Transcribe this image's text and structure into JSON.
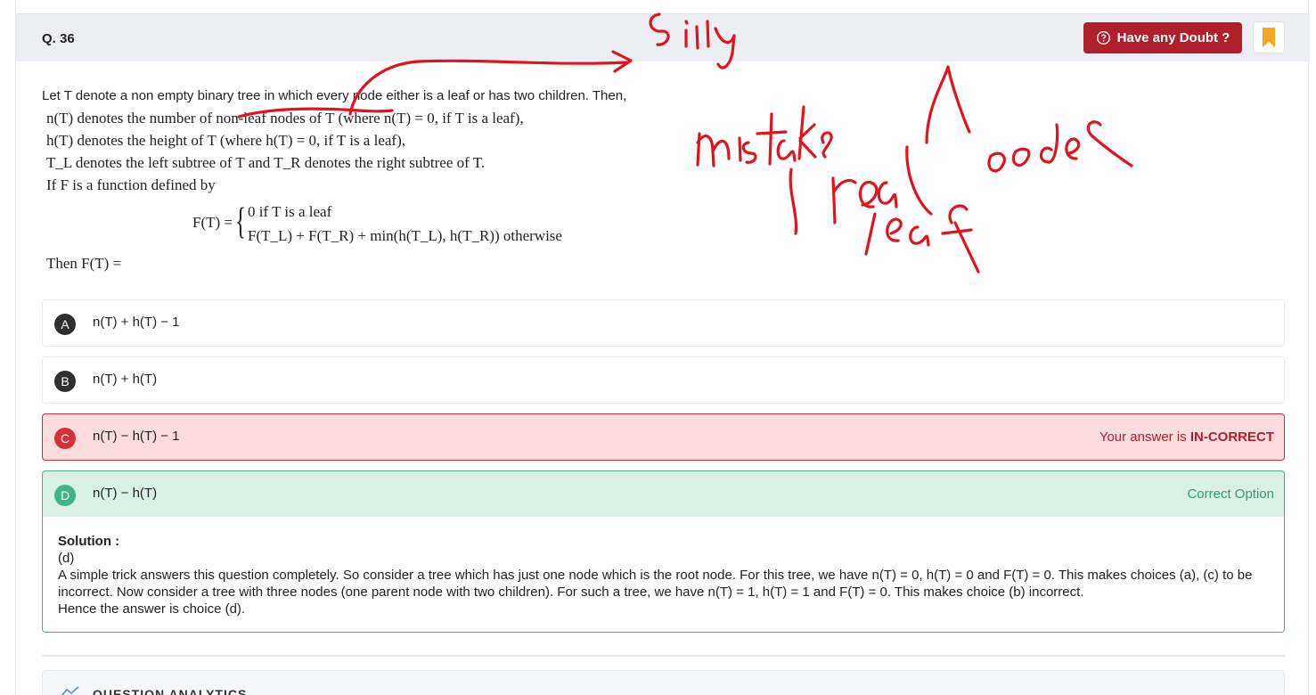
{
  "question": {
    "number": "Q. 36",
    "doubt_label": "Have any Doubt ?",
    "intro": "Let T denote a non empty binary tree in which every node either is a leaf or has two children. Then,",
    "lines": [
      "n(T) denotes the number of non-leaf nodes of T (where n(T) = 0, if T is a leaf),",
      "h(T) denotes the height of T (where h(T) = 0, if T is a leaf),",
      "T_L denotes the left subtree of T and T_R denotes the right subtree of T.",
      "If F is a function defined by"
    ],
    "formula_lhs": "F(T) =",
    "formula_case1": "0 if T is a leaf",
    "formula_case2": "F(T_L) + F(T_R) + min(h(T_L), h(T_R)) otherwise",
    "then_text": "Then F(T) ="
  },
  "options": [
    {
      "letter": "A",
      "text": "n(T) + h(T) − 1",
      "status": ""
    },
    {
      "letter": "B",
      "text": "n(T) + h(T)",
      "status": ""
    },
    {
      "letter": "C",
      "text": "n(T) − h(T) − 1",
      "status_prefix": "Your answer is ",
      "status_strong": "IN-CORRECT"
    },
    {
      "letter": "D",
      "text": "n(T) − h(T)",
      "status": "Correct Option"
    }
  ],
  "solution": {
    "heading": "Solution :",
    "answer": "(d)",
    "body1": "A simple trick answers this question completely. So consider a tree which has just one node which is the root node. For this tree, we have n(T) = 0, h(T) = 0 and F(T) = 0. This makes choices (a), (c) to be incorrect. Now consider a tree with three nodes (one parent node with two children). For such a tree, we have n(T) = 1, h(T) = 1 and F(T) = 0. This makes choice (b) incorrect.",
    "body2": "Hence the answer is choice (d)."
  },
  "analytics": {
    "title": "QUESTION ANALYTICS"
  },
  "colors": {
    "doubt_button": "#b1202a",
    "bookmark": "#f5a623",
    "incorrect_bg": "#fddcde",
    "correct_bg": "#d9f1e7",
    "ink": "#e0141e"
  }
}
